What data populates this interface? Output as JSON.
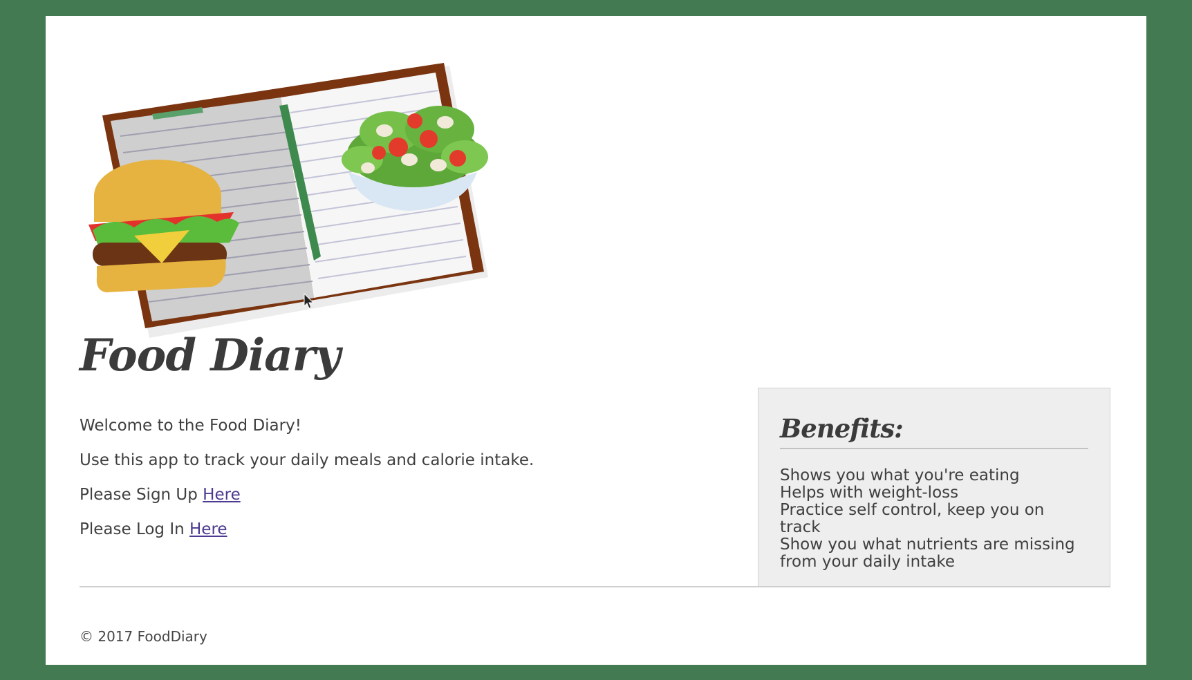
{
  "hero": {
    "illustration": "notebook-burger-salad-illustration"
  },
  "title": "Food Diary",
  "intro": {
    "welcome": "Welcome to the Food Diary!",
    "description": "Use this app to track your daily meals and calorie intake.",
    "signup_prefix": "Please Sign Up ",
    "signup_link": "Here",
    "login_prefix": "Please Log In ",
    "login_link": "Here"
  },
  "benefits": {
    "heading": "Benefits:",
    "items": [
      "Shows you what you're eating",
      "Helps with weight-loss",
      "Practice self control, keep you on track",
      "Show you what nutrients are missing",
      "from your daily intake"
    ]
  },
  "footer": {
    "copyright": "© 2017 FoodDiary"
  },
  "colors": {
    "frame": "#437a52",
    "page": "#ffffff",
    "text": "#3f3f3f",
    "link": "#4b3a8f",
    "benefits_bg": "#eeeeee"
  }
}
